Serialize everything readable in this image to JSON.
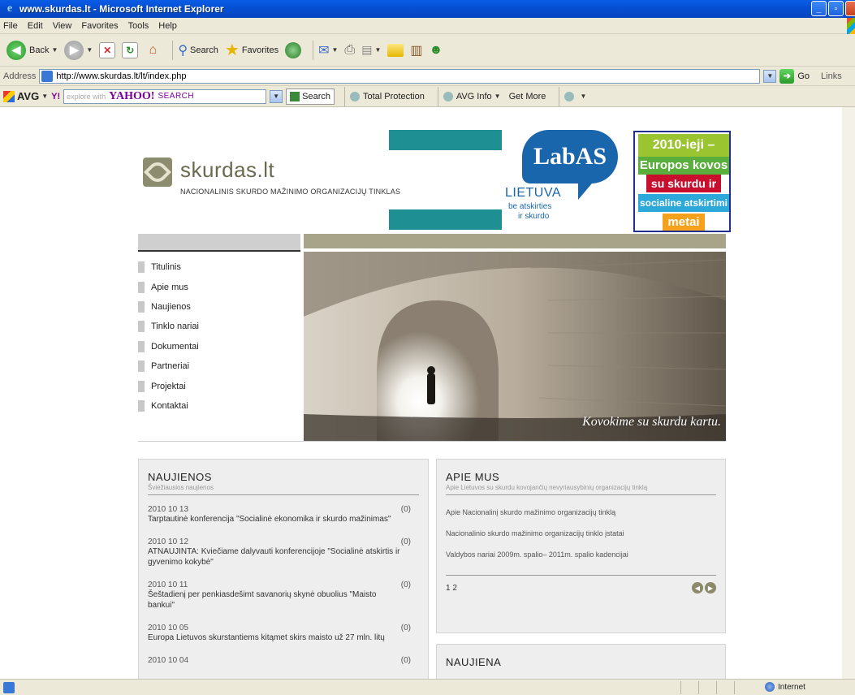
{
  "window": {
    "title": "www.skurdas.lt - Microsoft Internet Explorer",
    "buttons": [
      "_",
      "▫",
      "x"
    ]
  },
  "menubar": [
    "File",
    "Edit",
    "View",
    "Favorites",
    "Tools",
    "Help"
  ],
  "toolbar": {
    "back": "Back",
    "search": "Search",
    "favorites": "Favorites"
  },
  "address": {
    "label": "Address",
    "url": "http://www.skurdas.lt/lt/index.php",
    "go": "Go",
    "links": "Links"
  },
  "avgbar": {
    "brand": "AVG",
    "search_placeholder": "explore with",
    "yahoo": "YAHOO!",
    "yahoo_search": "SEARCH",
    "search_btn": "Search",
    "total_protection": "Total Protection",
    "avg_info": "AVG Info",
    "get_more": "Get More"
  },
  "site": {
    "name": "skurdas.lt",
    "tagline": "NACIONALINIS SKURDO MAŽINIMO ORGANIZACIJŲ TINKLAS",
    "labas": {
      "bubble": "LabAS",
      "country": "LIETUVA",
      "tag1": "be atskirties",
      "tag2": "ir skurdo"
    },
    "eu_banner": [
      "2010-ieji –",
      "Europos kovos",
      "su skurdu ir",
      "socialine atskirtimi",
      "metai"
    ],
    "hero_caption": "Kovokime su skurdu kartu."
  },
  "menu": [
    "Titulinis",
    "Apie mus",
    "Naujienos",
    "Tinklo nariai",
    "Dokumentai",
    "Partneriai",
    "Projektai",
    "Kontaktai"
  ],
  "news": {
    "title": "NAUJIENOS",
    "subtitle": "Šviežiausios naujienos",
    "items": [
      {
        "date": "2010 10 13",
        "text": "Tarptautinė konferencija \"Socialinė ekonomika ir skurdo mažinimas\"",
        "count": "(0)"
      },
      {
        "date": "2010 10 12",
        "text": "ATNAUJINTA: Kviečiame dalyvauti konferencijoje \"Socialinė atskirtis ir gyvenimo kokybė\"",
        "count": "(0)"
      },
      {
        "date": "2010 10 11",
        "text": "Šeštadienį per penkiasdešimt savanorių skynė obuolius \"Maisto bankui\"",
        "count": "(0)"
      },
      {
        "date": "2010 10 05",
        "text": "Europa Lietuvos skurstantiems kitąmet skirs maisto už 27 mln. litų",
        "count": "(0)"
      },
      {
        "date": "2010 10 04",
        "text": "",
        "count": "(0)"
      }
    ]
  },
  "about": {
    "title": "APIE MUS",
    "subtitle": "Apie Lietuvos su skurdu kovojančių nevyriausybinių organizacijų tinklą",
    "links": [
      "Apie Nacionalinį skurdo mažinimo organizacijų tinklą",
      "Nacionalinio skurdo mažinimo organizacijų tinklo įstatai",
      "Valdybos nariai 2009m. spalio– 2011m. spalio kadencijai"
    ],
    "pages": "1 2"
  },
  "naujiena": {
    "title": "NAUJIENA"
  },
  "status": {
    "zone": "Internet"
  }
}
